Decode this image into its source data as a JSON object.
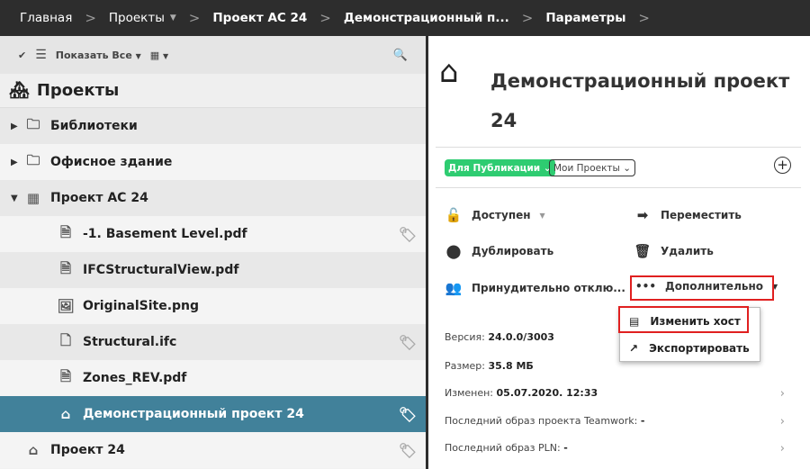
{
  "breadcrumb": [
    "Главная",
    "Проекты",
    "Проект АС 24",
    "Демонстрационный п...",
    "Параметры"
  ],
  "toolbar": {
    "show_all": "Показать Все"
  },
  "tree": {
    "header": "Проекты",
    "items": [
      {
        "label": "Библиотеки",
        "type": "folder"
      },
      {
        "label": "Офисное здание",
        "type": "folder"
      },
      {
        "label": "Проект АС 24",
        "type": "project-folder"
      },
      {
        "label": "-1. Basement Level.pdf",
        "type": "pdf"
      },
      {
        "label": "IFCStructuralView.pdf",
        "type": "pdf"
      },
      {
        "label": "OriginalSite.png",
        "type": "image"
      },
      {
        "label": "Structural.ifc",
        "type": "file"
      },
      {
        "label": "Zones_REV.pdf",
        "type": "pdf"
      },
      {
        "label": "Демонстрационный проект 24",
        "type": "project",
        "selected": true
      },
      {
        "label": "Проект 24",
        "type": "project"
      }
    ]
  },
  "detail": {
    "title": "Демонстрационный проект 24",
    "tags": [
      "Для Публикации",
      "Мои Проекты"
    ],
    "tag_color": "#2ecc71",
    "actions": {
      "available": "Доступен",
      "move": "Переместить",
      "duplicate": "Дублировать",
      "delete": "Удалить",
      "force": "Принудительно отклю...",
      "more": "Дополнительно"
    },
    "menu": [
      "Изменить хост",
      "Экспортировать"
    ],
    "info": [
      {
        "label": "Версия:",
        "value": "24.0.0/3003"
      },
      {
        "label": "Размер:",
        "value": "35.8 МБ"
      },
      {
        "label": "Изменен:",
        "value": "05.07.2020. 12:33"
      },
      {
        "label": "Последний образ проекта Teamwork:",
        "value": "-"
      },
      {
        "label": "Последний образ PLN:",
        "value": "-"
      }
    ]
  }
}
